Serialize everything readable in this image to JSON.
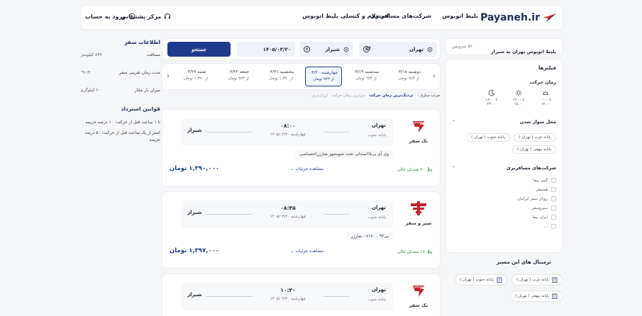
{
  "header": {
    "brand": "Payaneh.ir",
    "nav": [
      "بلیط اتوبوس",
      "شرکت‌های مسافربری",
      "استعلام و کنسلی بلیط اتوبوس"
    ],
    "support_label": "مرکز پشتیبانی",
    "login_label": "ورود به حساب"
  },
  "route_header": {
    "title": "بلیط اتوبوس تهران به شیراز",
    "count": "۵۲ سرویس"
  },
  "filters": {
    "title": "فیلترها",
    "time_title": "زمان حرکت",
    "time_slots": [
      "۰۰:۰۰ تا ۱۲:۰۰",
      "۱۲:۰۰ تا ۱۸:۰۰",
      "۱۸:۰۰ تا ۲۴:۰۰"
    ],
    "boarding_title": "محل سوار شدن",
    "boarding_places": [
      "پایانه غرب ( تهران )",
      "پایانه جنوب ( تهران )",
      "پایانه بیهقی ( تهران )"
    ],
    "companies_title": "شرکت‌های مسافربری",
    "companies": [
      "گیتی پیما",
      "همسفر",
      "رویال سفر ایرانیان",
      "سیروسفر",
      "ایران پیما",
      "..."
    ],
    "terminals_title": "ترمینال های این مسیر",
    "terminals": [
      "پایانه غرب ( تهران )",
      "پایانه جنوب ( تهران )",
      "پایانه بیهقی ( تهران )"
    ]
  },
  "search": {
    "origin": "تهران",
    "destination": "شیراز",
    "date": "۱۴۰۵/۰۳/۲۰",
    "button_label": "جستجو"
  },
  "dates": [
    {
      "day": "دوشنبه ۰۳/۱۸",
      "price": "از ۹۶۴ تومان"
    },
    {
      "day": "سه‌شنبه ۰۳/۱۹",
      "price": "از ۹۴۳ تومان"
    },
    {
      "day": "چهارشنبه ۰۳/۲۰",
      "price": "از ۹۴۳ تومان",
      "selected": true
    },
    {
      "day": "پنجشنبه ۰۳/۲۱",
      "price": "از ۱,۳۹۰ تومان"
    },
    {
      "day": "جمعه ۰۳/۲۲",
      "price": "از ۹۴۳ تومان"
    },
    {
      "day": "شنبه ۰۳/۲۳",
      "price": "از ۱,۳۹۰ تومان"
    }
  ],
  "sort": {
    "label": "مرتب سازی :",
    "options": [
      "نزدیک‌ترین زمان حرکت",
      "دیرترین زمان حرکت",
      "ارزان‌ترین"
    ]
  },
  "trips": [
    {
      "operator": "تک سفر",
      "from": "تهران",
      "terminal": "پایانه جنوب",
      "time": "۰۸:۰۰",
      "date": "چهارشنبه ۱۴۰۵/۰۳/۲۰",
      "to": "شیراز",
      "bus": "وی آی پی۲۵صندلی تخت شومجهز شارژراختصاصی",
      "seats": "۲۰ صندلی خالی",
      "details_label": "مشاهده جزئیات",
      "price": "۱,۳۹۰,۰۰۰ تومان"
    },
    {
      "operator": "سیر و سفر",
      "from": "تهران",
      "terminal": "پایانه جنوب",
      "time": "۰۸:۴۵",
      "date": "چهارشنبه ۱۴۰۵/۰۳/۲۰",
      "to": "شیراز",
      "bus": "بی۹۲ - ۷۱۶۰ - شارژر",
      "seats": "۱۶ صندلی خالی",
      "details_label": "مشاهده جزئیات",
      "price": "۱,۳۹۷,۰۰۰ تومان"
    },
    {
      "operator": "تک سفر",
      "from": "تهران",
      "terminal": "پایانه جنوب",
      "time": "۱۰:۳۰",
      "date": "چهارشنبه ۱۴۰۵/۰۳/۲۰",
      "to": "شیراز"
    }
  ],
  "trip_info": {
    "title": "اطلاعات سفر",
    "rows": [
      {
        "label": "مسافت",
        "value": "۸۳۷ کیلومتر"
      },
      {
        "label": "مدت زمان تقریبی سفر",
        "value": "۹:۱۴'"
      },
      {
        "label": "میزان بار مجاز",
        "value": "۲۰ کیلوگرم"
      }
    ]
  },
  "refund": {
    "title": "قوانین استرداد",
    "rules": [
      "تا ۱ ساعت قبل از حرکت: ۱۰ درصد جریمه",
      "کمتر از یک ساعت قبل از حرکت: ۵۰ درصد جریمه"
    ]
  }
}
